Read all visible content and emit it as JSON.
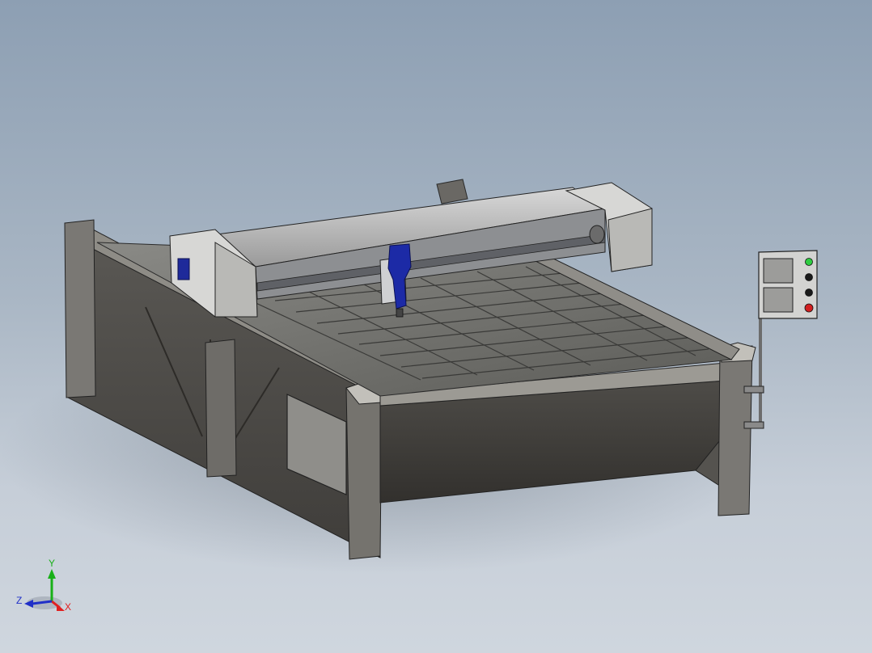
{
  "viewport": {
    "view_orientation": "isometric",
    "model": {
      "name": "cnc-plasma-cutting-table",
      "parts": [
        "frame",
        "slat-bed",
        "gantry",
        "torch-head",
        "control-panel"
      ]
    },
    "control_panel": {
      "buttons": [
        {
          "name": "start-button",
          "color": "#2ecc40"
        },
        {
          "name": "black-button-1",
          "color": "#1a1a1a"
        },
        {
          "name": "black-button-2",
          "color": "#1a1a1a"
        },
        {
          "name": "stop-button",
          "color": "#d21f1f"
        }
      ]
    },
    "triad": {
      "x_label": "X",
      "y_label": "Y",
      "z_label": "Z",
      "x_color": "#e02020",
      "y_color": "#18b018",
      "z_color": "#2030c8"
    }
  }
}
